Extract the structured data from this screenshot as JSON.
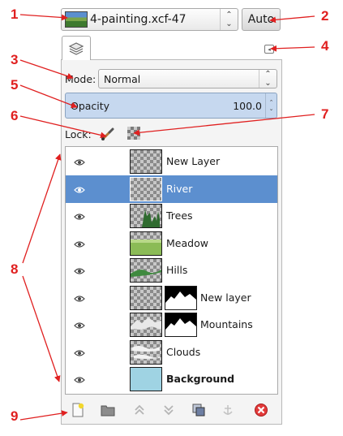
{
  "image_selector": {
    "name": "4-painting.xcf-47",
    "auto_label": "Auto"
  },
  "mode": {
    "label": "Mode:",
    "value": "Normal"
  },
  "opacity": {
    "label": "Opacity",
    "value": "100.0"
  },
  "lock": {
    "label": "Lock:"
  },
  "layers": [
    {
      "name": "New Layer",
      "visible": true,
      "selected": false,
      "bold": false,
      "thumb": "transparent"
    },
    {
      "name": "River",
      "visible": true,
      "selected": true,
      "bold": false,
      "thumb": "transparent"
    },
    {
      "name": "Trees",
      "visible": true,
      "selected": false,
      "bold": false,
      "thumb": "trees"
    },
    {
      "name": "Meadow",
      "visible": true,
      "selected": false,
      "bold": false,
      "thumb": "meadow"
    },
    {
      "name": "Hills",
      "visible": true,
      "selected": false,
      "bold": false,
      "thumb": "hills"
    },
    {
      "name": "New layer",
      "visible": true,
      "selected": false,
      "bold": false,
      "thumb": "transparent",
      "mask": true
    },
    {
      "name": "Mountains",
      "visible": true,
      "selected": false,
      "bold": false,
      "thumb": "mountains",
      "mask": true
    },
    {
      "name": "Clouds",
      "visible": true,
      "selected": false,
      "bold": false,
      "thumb": "clouds"
    },
    {
      "name": "Background",
      "visible": true,
      "selected": false,
      "bold": true,
      "thumb": "sky"
    }
  ],
  "toolbar": [
    "new-layer-icon",
    "new-layer-group-icon",
    "raise-layer-icon",
    "lower-layer-icon",
    "duplicate-layer-icon",
    "anchor-layer-icon",
    "delete-layer-icon"
  ],
  "callouts": [
    "1",
    "2",
    "3",
    "4",
    "5",
    "6",
    "7",
    "8",
    "9"
  ],
  "colors": {
    "selection": "#5c8fcf",
    "callout": "#e02020",
    "opacity_field": "#c6d8ef"
  }
}
